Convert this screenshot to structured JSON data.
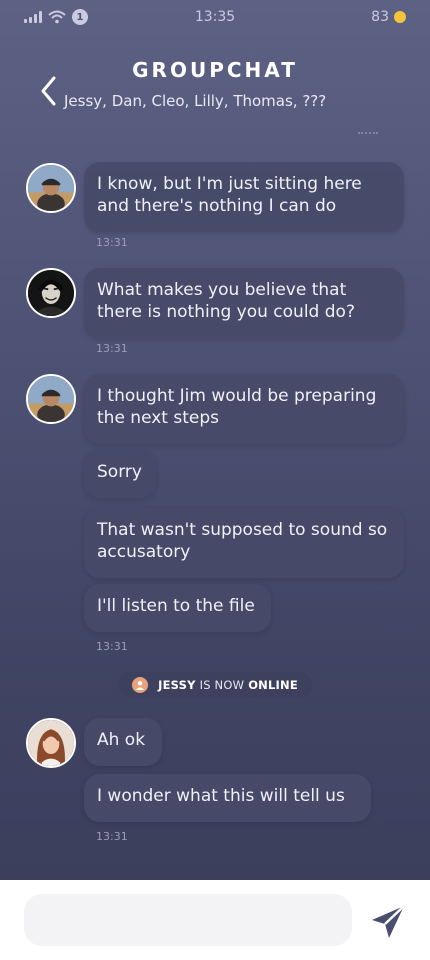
{
  "status_bar": {
    "badge": "1",
    "time": "13:35",
    "battery": "83"
  },
  "header": {
    "title": "GROUPCHAT",
    "members": "Jessy, Dan, Cleo, Lilly, Thomas, ???"
  },
  "messages": [
    {
      "avatar": "avatar-man-cap",
      "text": "I know, but I'm just sitting here and there's nothing I can do"
    },
    {
      "avatar": "avatar-masked-figure",
      "text": "What makes you believe that there is nothing you could do?"
    },
    {
      "avatar": "avatar-man-cap",
      "text": "I thought Jim would be preparing the next steps"
    },
    {
      "text": "Sorry"
    },
    {
      "text": "That wasn't supposed to sound so accusatory"
    },
    {
      "text": "I'll listen to the file"
    },
    {
      "avatar": "avatar-woman",
      "text": "Ah ok"
    },
    {
      "text": "I wonder what this will tell us"
    }
  ],
  "timestamps": [
    "13:31",
    "13:31",
    "13:31",
    "13:31"
  ],
  "system_notice": {
    "name": "JESSY",
    "middle": "IS NOW",
    "status": "ONLINE",
    "icon": "user-icon"
  },
  "composer": {
    "placeholder": "",
    "send_icon": "send-icon"
  },
  "colors": {
    "background_top": "#5d6285",
    "background_bottom": "#3a3d58",
    "bubble": "#464a68",
    "accent_coin": "#f3c43b"
  }
}
